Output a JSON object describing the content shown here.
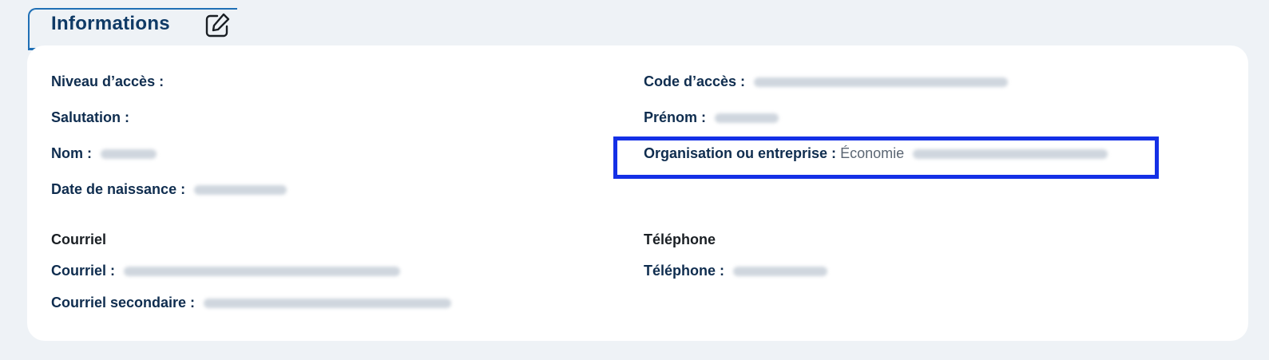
{
  "header": {
    "title": "Informations",
    "edit_icon": "edit-icon"
  },
  "fields": {
    "niveau_acces_label": "Niveau d’accès :",
    "code_acces_label": "Code d’accès :",
    "salutation_label": "Salutation :",
    "prenom_label": "Prénom :",
    "nom_label": "Nom :",
    "organisation_label": "Organisation ou entreprise :",
    "organisation_value": "Économie",
    "date_naissance_label": "Date de naissance :"
  },
  "sections": {
    "courriel_title": "Courriel",
    "telephone_title": "Téléphone",
    "courriel_label": "Courriel :",
    "courriel_secondaire_label": "Courriel secondaire :",
    "telephone_label": "Téléphone :"
  },
  "colors": {
    "accent": "#1f6fb5",
    "highlight": "#1430e6",
    "background": "#eef2f6"
  }
}
